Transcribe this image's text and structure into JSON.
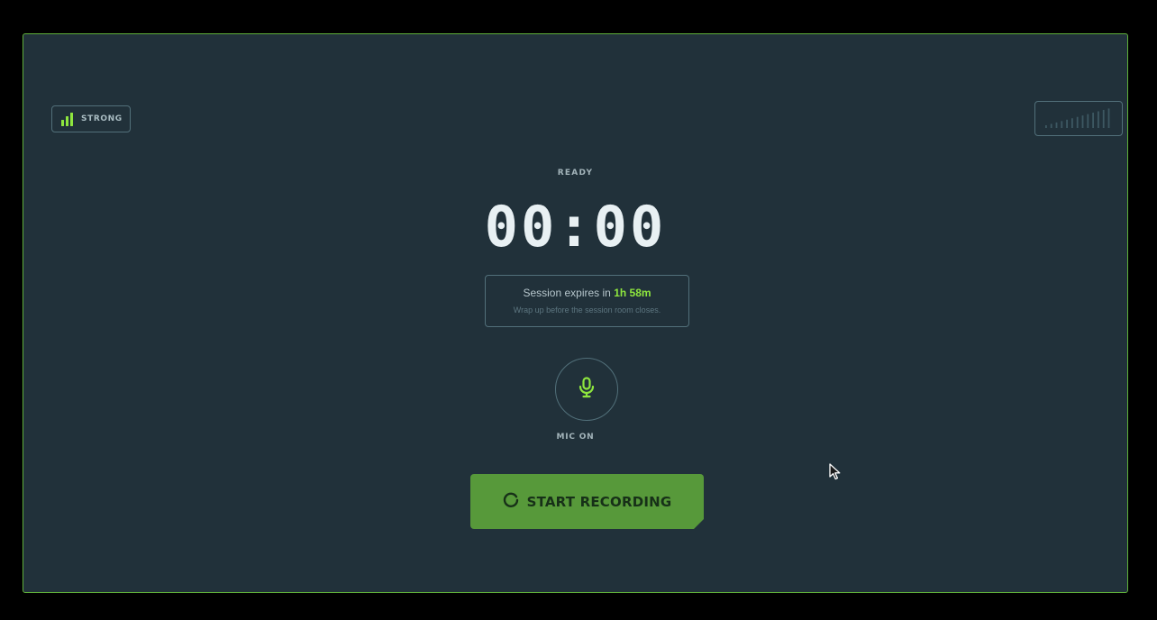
{
  "connection": {
    "label": "STRONG",
    "icon": "signal-bars-icon",
    "bars_active": 3,
    "bars_total": 3,
    "color": "#8ee63e"
  },
  "level_meter": {
    "icon": "audio-level-meter-icon",
    "level": 0
  },
  "recorder": {
    "status": "READY",
    "timer": "00:00"
  },
  "session": {
    "expiry_prefix": "Session expires in",
    "expiry_time": "1h 58m",
    "note": "Wrap up before the session room closes."
  },
  "mic": {
    "icon": "microphone-icon",
    "label": "MIC ON"
  },
  "record_button": {
    "icon": "spinner-icon",
    "label": "START RECORDING"
  },
  "colors": {
    "accent": "#8ee63e",
    "panel_bg": "#21313a",
    "panel_border": "#5fb03a",
    "button_bg": "#57993a"
  }
}
